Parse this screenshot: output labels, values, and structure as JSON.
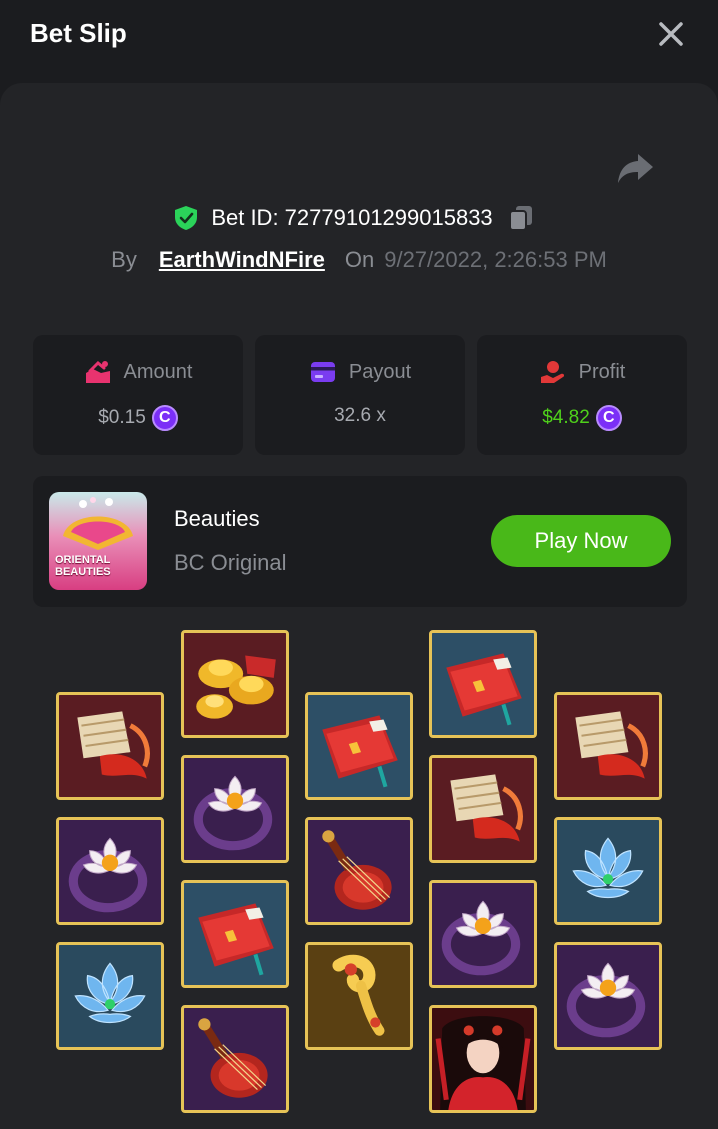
{
  "header": {
    "title": "Bet Slip"
  },
  "bet": {
    "id_text": "Bet ID: 72779101299015833",
    "by_label": "By",
    "user": "EarthWindNFire",
    "on_label": "On",
    "datetime": "9/27/2022, 2:26:53 PM"
  },
  "stats": {
    "amount": {
      "label": "Amount",
      "value": "$0.15"
    },
    "payout": {
      "label": "Payout",
      "value": "32.6 x"
    },
    "profit": {
      "label": "Profit",
      "value": "$4.82"
    }
  },
  "currency_icon": "C",
  "game": {
    "name": "Beauties",
    "provider": "BC Original",
    "thumb_text": "ORIENTAL BEAUTIES",
    "play_label": "Play Now"
  },
  "colors": {
    "background": "#1b1c1f",
    "panel": "#232427",
    "accent_green": "#49b819",
    "profit_green": "#4fd11b",
    "coin_purple": "#7b2ff7",
    "tile_gold": "#e6c357"
  },
  "grid": {
    "columns": [
      [
        "fan-koi",
        "lotus-ring",
        "blue-lotus"
      ],
      [
        "gold-ingots",
        "lotus-ring",
        "red-book",
        "pipa"
      ],
      [
        "red-book",
        "pipa",
        "ruyi"
      ],
      [
        "red-book",
        "fan-koi",
        "lotus-ring",
        "beauty"
      ],
      [
        "fan-koi",
        "blue-lotus",
        "lotus-ring"
      ]
    ]
  }
}
